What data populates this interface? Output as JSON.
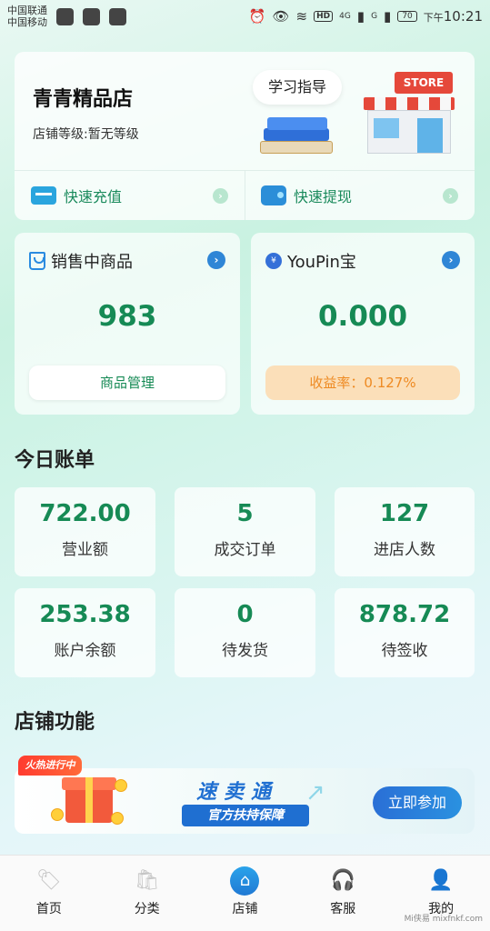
{
  "status_bar": {
    "carrier1": "中国联通",
    "carrier2": "中国移动",
    "network_4g": "4G",
    "network_g": "G",
    "hd": "HD",
    "battery": "70",
    "time_prefix": "下午",
    "time": "10:21"
  },
  "store": {
    "name": "青青精品店",
    "level": "店铺等级:暂无等级",
    "guide_label": "学习指导",
    "sign": "STORE",
    "quick_recharge": "快速充值",
    "quick_withdraw": "快速提现"
  },
  "on_sale": {
    "title": "销售中商品",
    "value": "983",
    "button": "商品管理"
  },
  "youpin": {
    "title": "YouPin宝",
    "value": "0.000",
    "yield": "收益率：0.127%"
  },
  "today": {
    "title": "今日账单",
    "items": [
      {
        "value": "722.00",
        "label": "营业额"
      },
      {
        "value": "5",
        "label": "成交订单"
      },
      {
        "value": "127",
        "label": "进店人数"
      },
      {
        "value": "253.38",
        "label": "账户余额"
      },
      {
        "value": "0",
        "label": "待发货"
      },
      {
        "value": "878.72",
        "label": "待签收"
      }
    ]
  },
  "functions": {
    "title": "店铺功能",
    "banner": {
      "hot_tag": "火热进行中",
      "title": "速卖通",
      "subtitle": "官方扶持保障",
      "join": "立即参加"
    }
  },
  "nav": {
    "items": [
      {
        "label": "首页",
        "icon": "tag-icon"
      },
      {
        "label": "分类",
        "icon": "bag-icon"
      },
      {
        "label": "店铺",
        "icon": "home-icon"
      },
      {
        "label": "客服",
        "icon": "headset-icon"
      },
      {
        "label": "我的",
        "icon": "user-icon"
      }
    ],
    "active": "店铺"
  },
  "watermark": "Mi侠易 mixfnkf.com"
}
